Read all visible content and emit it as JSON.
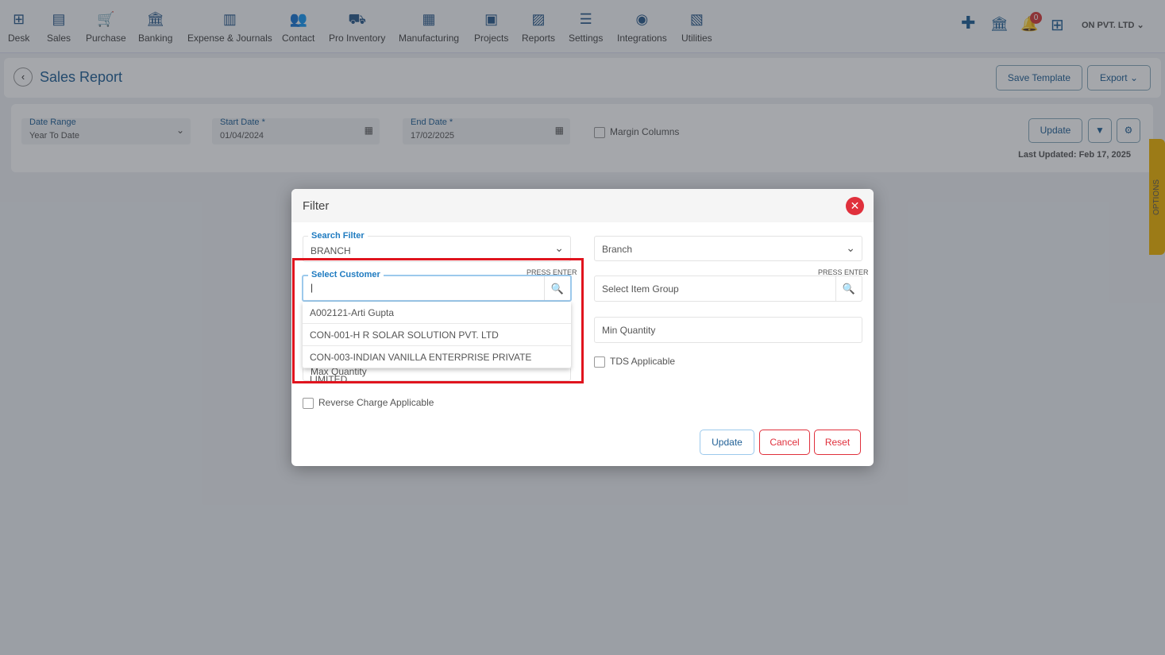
{
  "nav": {
    "items": [
      {
        "label": "Desk",
        "icon": "desk-icon",
        "glyph": "⊞"
      },
      {
        "label": "Sales",
        "icon": "sales-icon",
        "glyph": "▤"
      },
      {
        "label": "Purchase",
        "icon": "cart-icon",
        "glyph": "🛒"
      },
      {
        "label": "Banking",
        "icon": "bank-icon",
        "glyph": "🏛"
      },
      {
        "label": "Expense & Journals",
        "icon": "journal-icon",
        "glyph": "▥"
      },
      {
        "label": "Contact",
        "icon": "contact-icon",
        "glyph": "👥"
      },
      {
        "label": "Pro Inventory",
        "icon": "inventory-icon",
        "glyph": "⛟"
      },
      {
        "label": "Manufacturing",
        "icon": "manufacturing-icon",
        "glyph": "▦"
      },
      {
        "label": "Projects",
        "icon": "projects-icon",
        "glyph": "▣"
      },
      {
        "label": "Reports",
        "icon": "reports-icon",
        "glyph": "▨"
      },
      {
        "label": "Settings",
        "icon": "settings-sliders-icon",
        "glyph": "☰"
      },
      {
        "label": "Integrations",
        "icon": "integrations-icon",
        "glyph": "◉"
      },
      {
        "label": "Utilities",
        "icon": "utilities-icon",
        "glyph": "▧"
      }
    ],
    "notification_count": "0",
    "company": "ON PVT. LTD"
  },
  "page": {
    "title": "Sales Report",
    "save_template": "Save Template",
    "export": "Export"
  },
  "filters": {
    "date_range_label": "Date Range",
    "date_range": "Year To Date",
    "start_label": "Start Date *",
    "start": "01/04/2024",
    "end_label": "End Date *",
    "end": "17/02/2025",
    "margin": "Margin Columns",
    "update": "Update",
    "last_updated": "Last Updated: Feb 17, 2025",
    "options": "OPTIONS"
  },
  "modal": {
    "title": "Filter",
    "search_filter_label": "Search Filter",
    "search_filter": "BRANCH",
    "branch_placeholder": "Branch",
    "customer_label": "Select Customer",
    "press_enter": "PRESS ENTER",
    "item_group_placeholder": "Select Item Group",
    "min_qty": "Min Quantity",
    "max_qty": "Max Quantity",
    "tds": "TDS Applicable",
    "reverse": "Reverse Charge Applicable",
    "options": [
      "A002121-Arti Gupta",
      "CON-001-H R SOLAR SOLUTION PVT. LTD",
      "CON-003-INDIAN VANILLA ENTERPRISE PRIVATE LIMITED"
    ],
    "update": "Update",
    "cancel": "Cancel",
    "reset": "Reset"
  },
  "colors": {
    "accent": "#1f5f95",
    "danger": "#e0303c",
    "highlight": "#e0141e",
    "options_tab": "#f0b400"
  }
}
